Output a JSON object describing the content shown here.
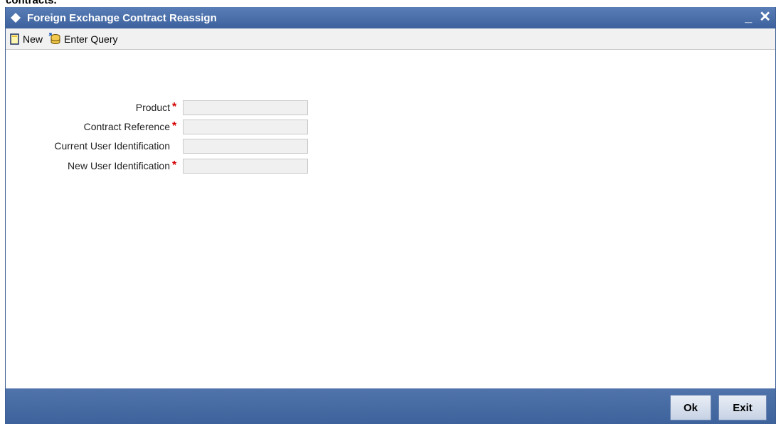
{
  "page_heading_fragment": "contracts.",
  "window": {
    "title": "Foreign Exchange Contract Reassign",
    "minimize_label": "_",
    "close_label": "✕"
  },
  "toolbar": {
    "new_label": "New",
    "enter_query_label": "Enter Query"
  },
  "form": {
    "product": {
      "label": "Product",
      "required": "*",
      "value": ""
    },
    "contract_reference": {
      "label": "Contract Reference",
      "required": "*",
      "value": ""
    },
    "current_user_identification": {
      "label": "Current User Identification",
      "required": "",
      "value": ""
    },
    "new_user_identification": {
      "label": "New User Identification",
      "required": "*",
      "value": ""
    }
  },
  "footer": {
    "ok_label": "Ok",
    "exit_label": "Exit"
  },
  "colors": {
    "titlebar": "#4a6fa8",
    "footer": "#466aa3",
    "required_marker": "#d40000"
  }
}
